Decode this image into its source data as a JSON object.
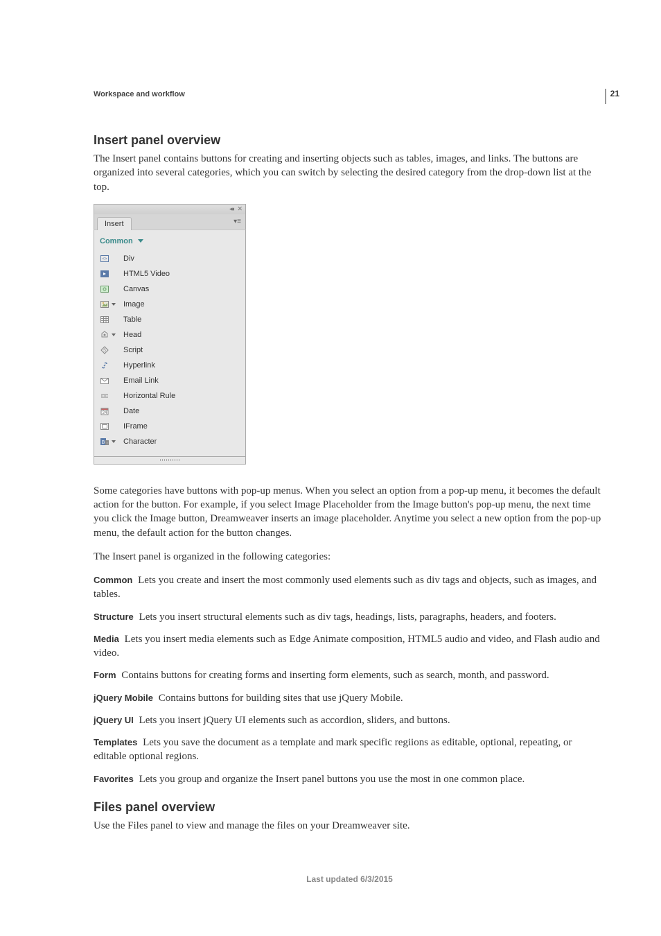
{
  "page_number": "21",
  "header": {
    "section": "Workspace and workflow"
  },
  "section1": {
    "title": "Insert panel overview",
    "para1": "The Insert panel contains buttons for creating and inserting objects such as tables, images, and links. The buttons are organized into several categories, which you can switch by selecting the desired category from the drop-down list at the top."
  },
  "panel": {
    "tab": "Insert",
    "dropdown": "Common",
    "items": [
      {
        "icon": "div",
        "label": "Div",
        "sub": false
      },
      {
        "icon": "html5v",
        "label": "HTML5 Video",
        "sub": false
      },
      {
        "icon": "canvas",
        "label": "Canvas",
        "sub": false
      },
      {
        "icon": "image",
        "label": "Image",
        "sub": true
      },
      {
        "icon": "table",
        "label": "Table",
        "sub": false
      },
      {
        "icon": "head",
        "label": "Head",
        "sub": true
      },
      {
        "icon": "script",
        "label": "Script",
        "sub": false
      },
      {
        "icon": "hyper",
        "label": "Hyperlink",
        "sub": false
      },
      {
        "icon": "email",
        "label": "Email Link",
        "sub": false
      },
      {
        "icon": "hr",
        "label": "Horizontal Rule",
        "sub": false
      },
      {
        "icon": "date",
        "label": "Date",
        "sub": false
      },
      {
        "icon": "iframe",
        "label": "IFrame",
        "sub": false
      },
      {
        "icon": "char",
        "label": "Character",
        "sub": true
      }
    ]
  },
  "section1b": {
    "para2": "Some categories have buttons with pop-up menus. When you select an option from a pop-up menu, it becomes the default action for the button. For example, if you select Image Placeholder from the Image button's pop-up menu, the next time you click the Image button, Dreamweaver inserts an image placeholder. Anytime you select a new option from the pop-up menu, the default action for the button changes.",
    "para3": "The Insert panel is organized in the following categories:"
  },
  "defs": [
    {
      "term": "Common",
      "text": "Lets you create and insert the most commonly used elements such as div tags and objects, such as images, and tables."
    },
    {
      "term": "Structure",
      "text": "Lets you insert structural elements such as div tags, headings, lists, paragraphs, headers, and footers."
    },
    {
      "term": "Media",
      "text": "Lets you insert media elements such as Edge Animate composition, HTML5 audio and video, and Flash audio and video."
    },
    {
      "term": "Form",
      "text": "Contains buttons for creating forms and inserting form elements, such as search, month, and password."
    },
    {
      "term": "jQuery Mobile",
      "text": "Contains buttons for building sites that use jQuery Mobile."
    },
    {
      "term": "jQuery UI",
      "text": "Lets you insert jQuery UI elements such as accordion, sliders, and buttons."
    },
    {
      "term": "Templates",
      "text": "Lets you save the document as a template and mark specific regiions as editable, optional, repeating, or editable optional regions."
    },
    {
      "term": "Favorites",
      "text": "Lets you group and organize the Insert panel buttons you use the most in one common place."
    }
  ],
  "section2": {
    "title": "Files panel overview",
    "para1": "Use the Files panel to view and manage the files on your Dreamweaver site."
  },
  "footer": {
    "updated": "Last updated 6/3/2015"
  }
}
